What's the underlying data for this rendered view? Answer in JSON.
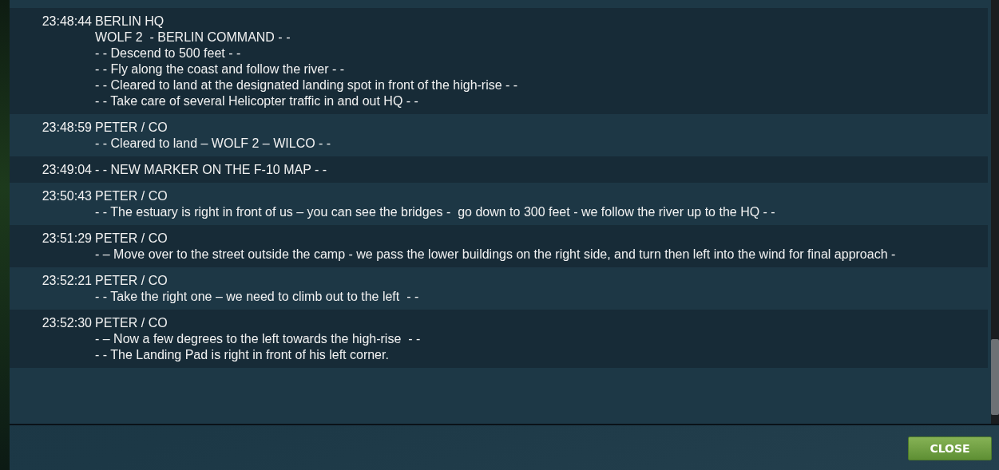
{
  "log": [
    {
      "time": "23:48:44",
      "lines": [
        "BERLIN HQ",
        "WOLF 2  - BERLIN COMMAND - -",
        "- - Descend to 500 feet - -",
        "- - Fly along the coast and follow the river - -",
        "- - Cleared to land at the designated landing spot in front of the high-rise - -",
        "- - Take care of several Helicopter traffic in and out HQ - -"
      ]
    },
    {
      "time": "23:48:59",
      "lines": [
        "PETER / CO",
        "- - Cleared to land – WOLF 2 – WILCO - -"
      ]
    },
    {
      "time": "23:49:04",
      "lines": [
        "- - NEW MARKER ON THE F-10 MAP - -"
      ]
    },
    {
      "time": "23:50:43",
      "lines": [
        "PETER / CO",
        "- - The estuary is right in front of us – you can see the bridges -  go down to 300 feet - we follow the river up to the HQ - -"
      ]
    },
    {
      "time": "23:51:29",
      "lines": [
        "PETER / CO",
        "- – Move over to the street outside the camp - we pass the lower buildings on the right side, and turn then left into the wind for final approach -"
      ]
    },
    {
      "time": "23:52:21",
      "lines": [
        "PETER / CO",
        "- - Take the right one – we need to climb out to the left  - -"
      ]
    },
    {
      "time": "23:52:30",
      "lines": [
        "PETER / CO",
        "- – Now a few degrees to the left towards the high-rise  - -",
        "- - The Landing Pad is right in front of his left corner."
      ]
    }
  ],
  "close_button": "CLOSE"
}
